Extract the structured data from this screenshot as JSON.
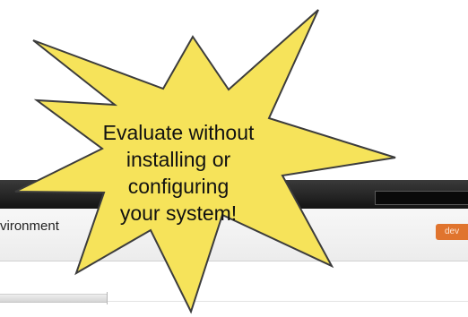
{
  "header": {
    "badge": "dev"
  },
  "page": {
    "title": "vironment"
  },
  "callout": {
    "text": "Evaluate without\ninstalling or configuring\nyour system!",
    "fill": "#f6e35a",
    "stroke": "#3c3c3c"
  },
  "colors": {
    "topbar": "#1e1e1e",
    "accent": "#e0742e"
  }
}
